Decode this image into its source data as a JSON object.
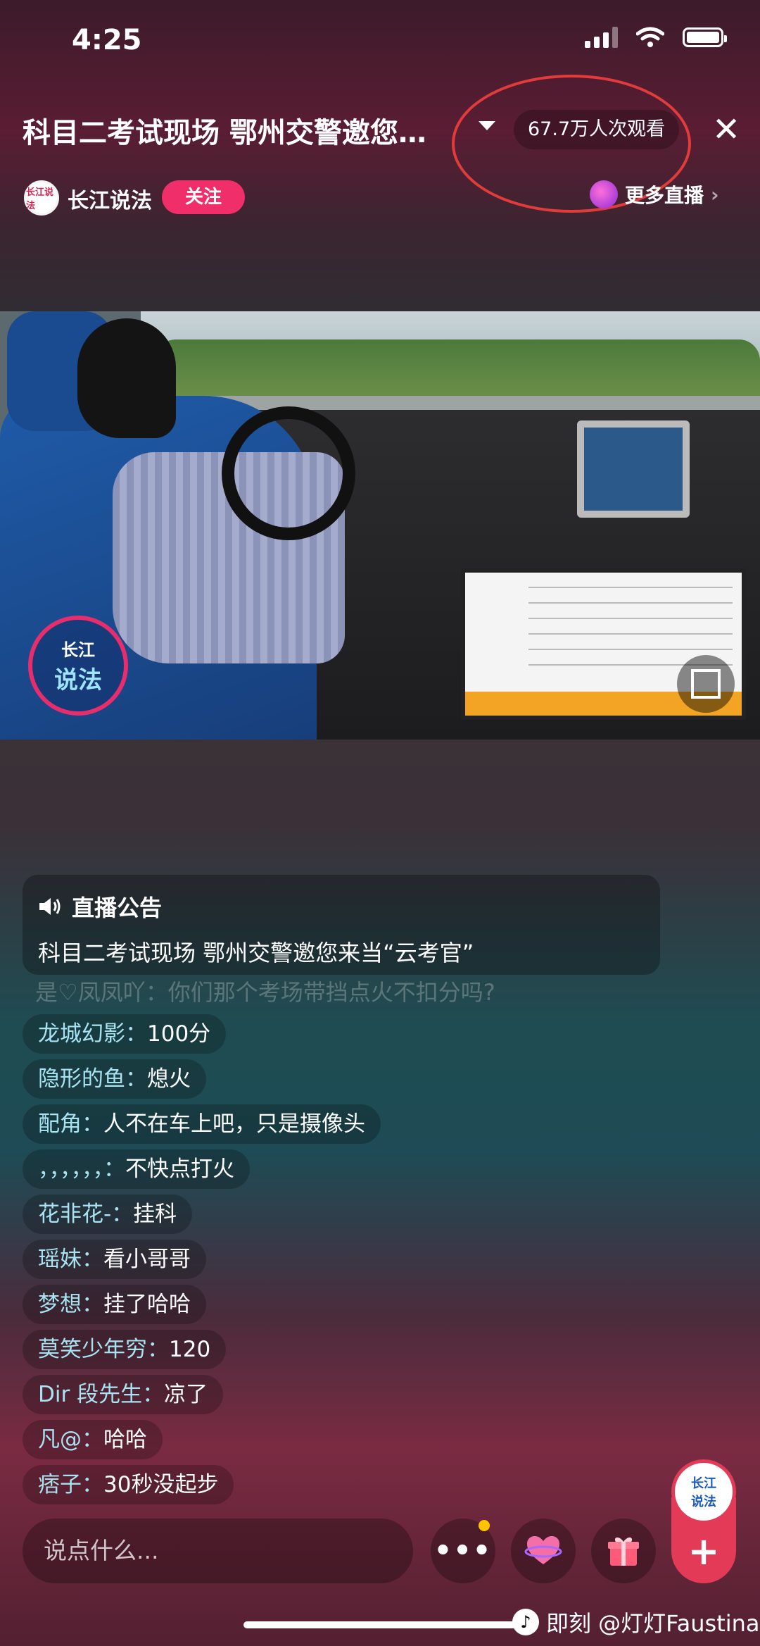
{
  "status_bar": {
    "time": "4:25"
  },
  "header": {
    "title": "科目二考试现场 鄂州交警邀您…",
    "viewers": "67.7万人次观看",
    "close": "✕"
  },
  "channel": {
    "name": "长江说法",
    "follow_label": "关注",
    "more_live_label": "更多直播",
    "more_live_chevron": "›"
  },
  "video": {
    "logo_line1": "长江",
    "logo_line2": "说法"
  },
  "announcement": {
    "heading": "直播公告",
    "text": "科目二考试现场 鄂州交警邀您来当“云考官”"
  },
  "faded_message": "是♡凤凤吖：你们那个考场带挡点火不扣分吗?",
  "chat": {
    "messages": [
      {
        "user": "龙城幻影：",
        "text": "100分"
      },
      {
        "user": "隐形的鱼：",
        "text": "熄火"
      },
      {
        "user": "配角：",
        "text": "人不在车上吧，只是摄像头"
      },
      {
        "user": "，，，，，，：",
        "text": "不快点打火"
      },
      {
        "user": "花非花-：",
        "text": "挂科"
      },
      {
        "user": "瑶妹：",
        "text": "看小哥哥"
      },
      {
        "user": "梦想：",
        "text": "挂了哈哈"
      },
      {
        "user": "莫笑少年穷：",
        "text": "120"
      },
      {
        "user": "Dir 段先生：",
        "text": "凉了"
      },
      {
        "user": "凡@：",
        "text": "哈哈"
      },
      {
        "user": "痞子：",
        "text": "30秒没起步"
      }
    ]
  },
  "bottom_bar": {
    "input_placeholder": "说点什么...",
    "more_label": "•••",
    "plus_label": "+",
    "corner_logo_1": "长江",
    "corner_logo_2": "说法"
  },
  "watermark": {
    "logo": "♪",
    "text": "即刻 @灯灯Faustina"
  },
  "colors": {
    "accent": "#f02e6a",
    "chat_user": "#a8e3f2",
    "highlight_circle": "#e13b3b"
  }
}
